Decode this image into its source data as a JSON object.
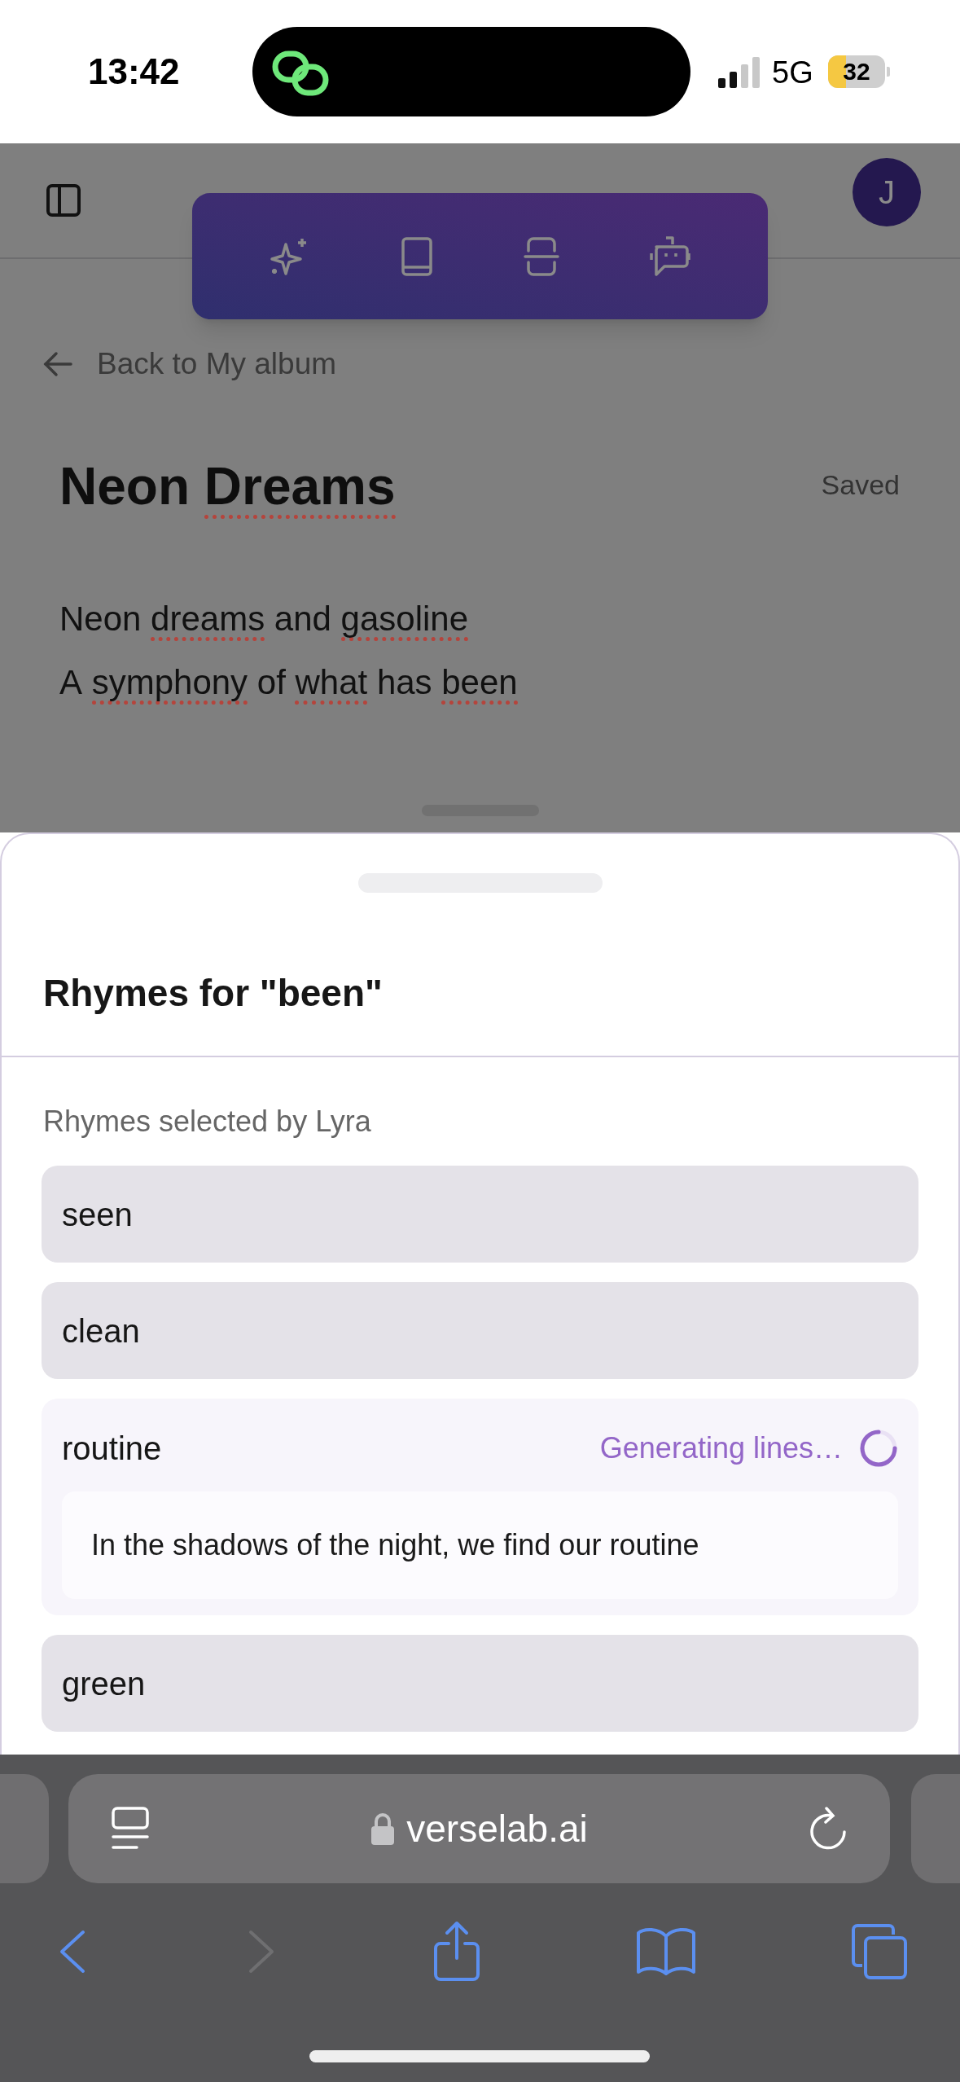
{
  "status_bar": {
    "time": "13:42",
    "network": "5G",
    "battery": "32"
  },
  "header": {
    "avatar": "J"
  },
  "back_link": "Back to My album",
  "song": {
    "title": [
      {
        "text": "Neon",
        "flagged": false
      },
      {
        "text": "Dreams",
        "flagged": true
      }
    ],
    "save_status": "Saved",
    "lyrics": [
      {
        "words": [
          {
            "text": "Neon",
            "flagged": false
          },
          {
            "text": "dreams",
            "flagged": true
          },
          {
            "text": "and",
            "flagged": false
          },
          {
            "text": "gasoline",
            "flagged": true
          }
        ]
      },
      {
        "words": [
          {
            "text": "A",
            "flagged": false
          },
          {
            "text": "symphony",
            "flagged": true
          },
          {
            "text": "of",
            "flagged": false
          },
          {
            "text": "what",
            "flagged": true
          },
          {
            "text": "has",
            "flagged": false
          },
          {
            "text": "been",
            "flagged": true
          }
        ]
      }
    ]
  },
  "sheet": {
    "title": "Rhymes for \"been\"",
    "section_label": "Rhymes selected by Lyra",
    "rhymes": [
      {
        "kind": "plain",
        "word": "seen"
      },
      {
        "kind": "plain",
        "word": "clean"
      },
      {
        "kind": "generating",
        "word": "routine",
        "status": "Generating lines…",
        "lines": [
          "In the shadows of the night, we find our routine"
        ]
      },
      {
        "kind": "plain",
        "word": "green"
      }
    ]
  },
  "browser": {
    "url": "verselab.ai",
    "back": {
      "disabled": false
    },
    "forward": {
      "disabled": true
    }
  }
}
